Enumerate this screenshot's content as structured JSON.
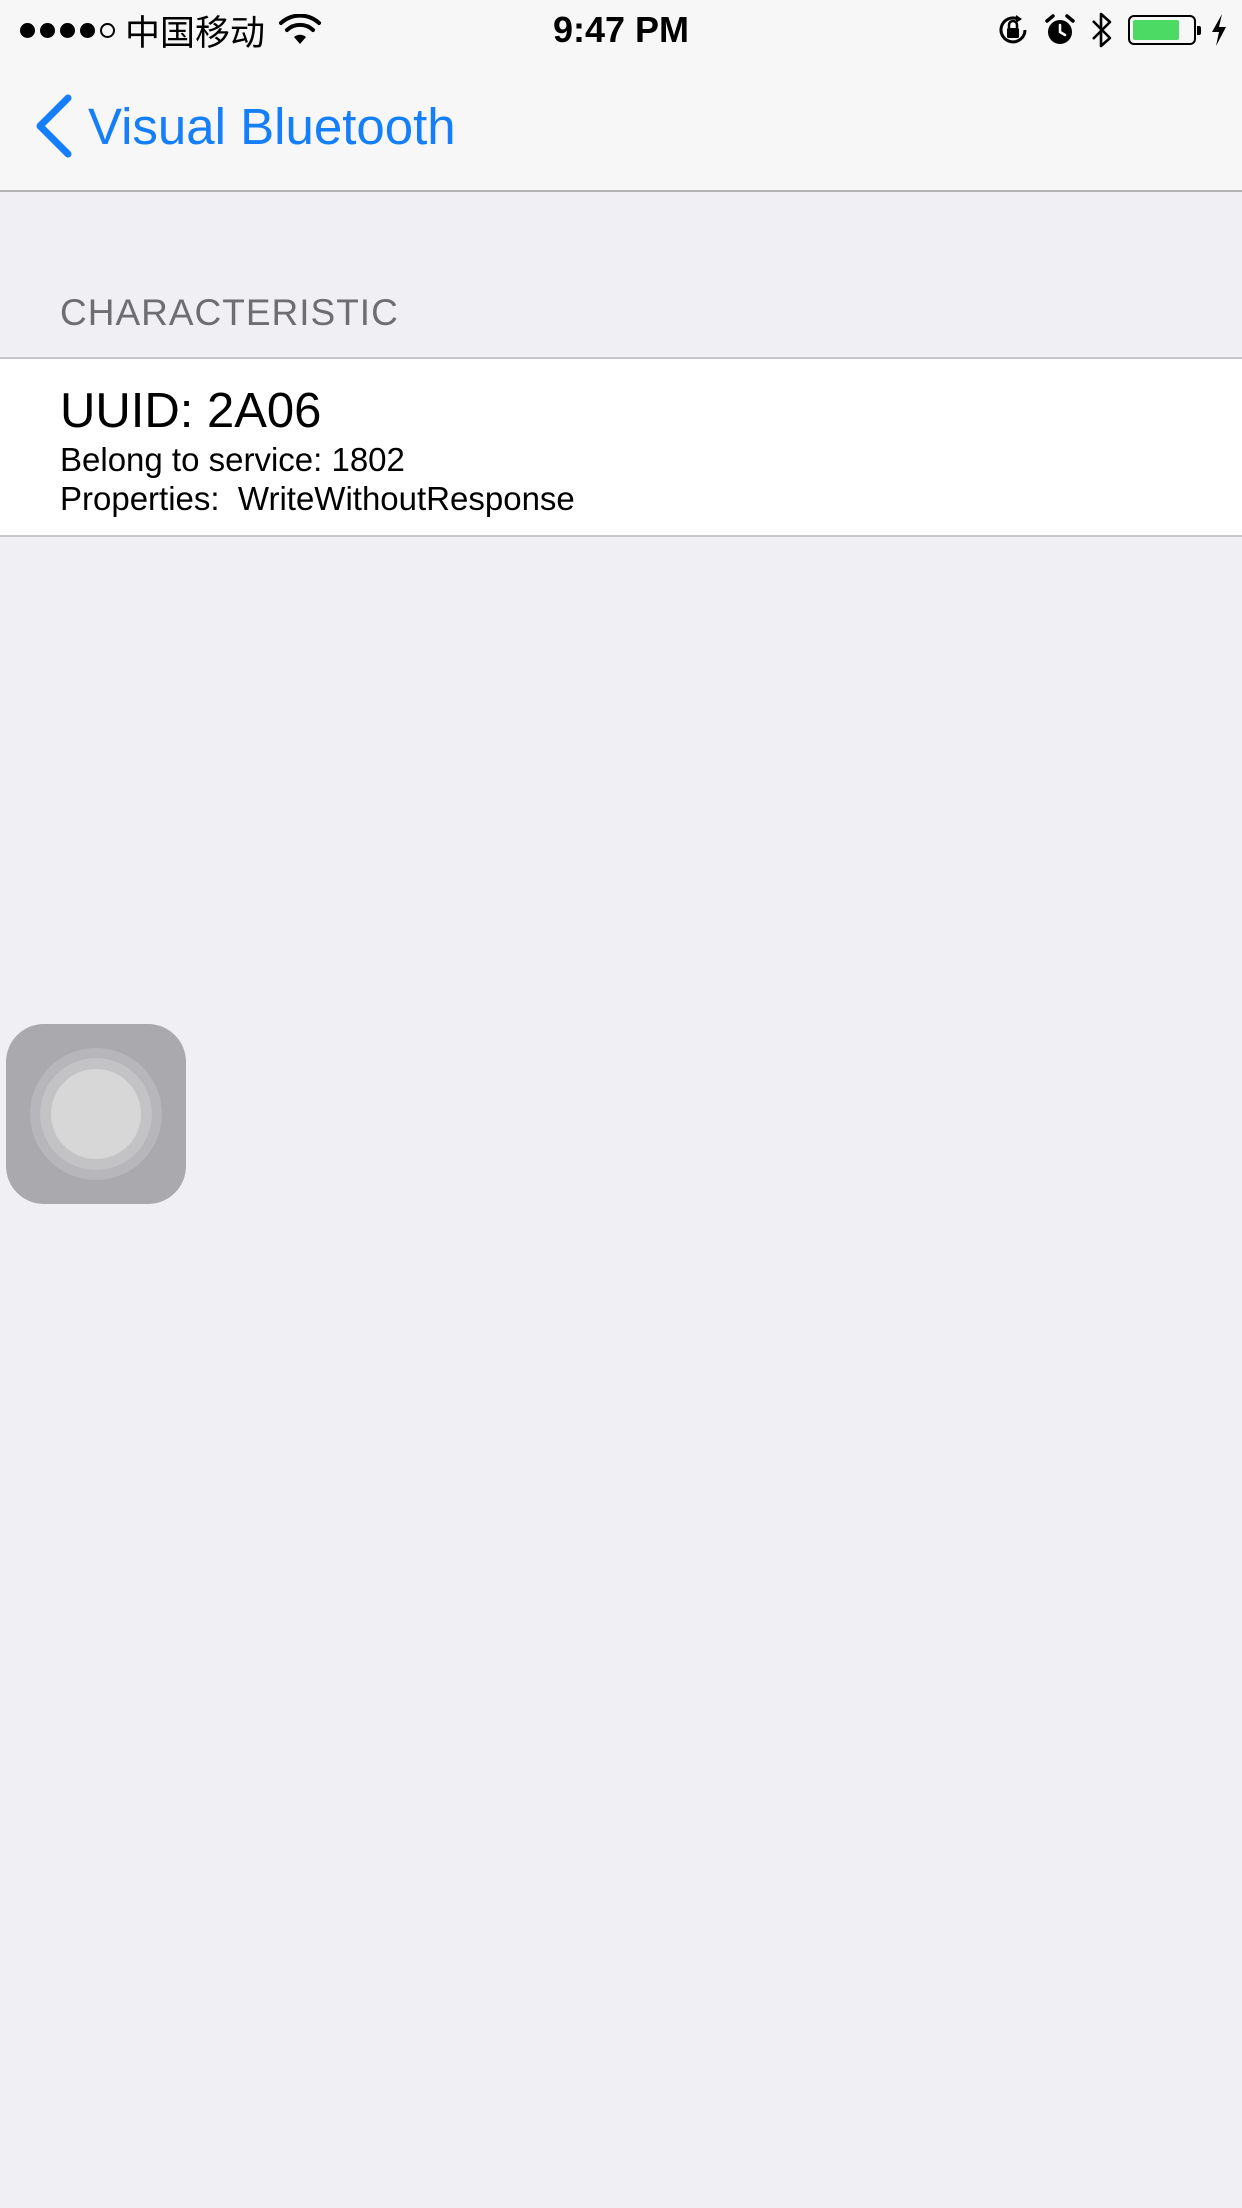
{
  "status_bar": {
    "carrier": "中国移动",
    "time": "9:47 PM",
    "signal_strength": "4 of 5",
    "battery_level": 0.8,
    "icons": [
      "wifi-icon",
      "rotation-lock-icon",
      "alarm-icon",
      "bluetooth-icon",
      "battery-icon",
      "charging-bolt-icon"
    ]
  },
  "nav_bar": {
    "back_label": "Visual Bluetooth"
  },
  "section": {
    "header": "CHARACTERISTIC",
    "cell": {
      "title": "UUID: 2A06",
      "service_line": "Belong to service: 1802",
      "properties_line": "Properties:  WriteWithoutResponse"
    }
  },
  "colors": {
    "accent": "#147efb",
    "background": "#efeff4",
    "battery": "#4cd964"
  }
}
